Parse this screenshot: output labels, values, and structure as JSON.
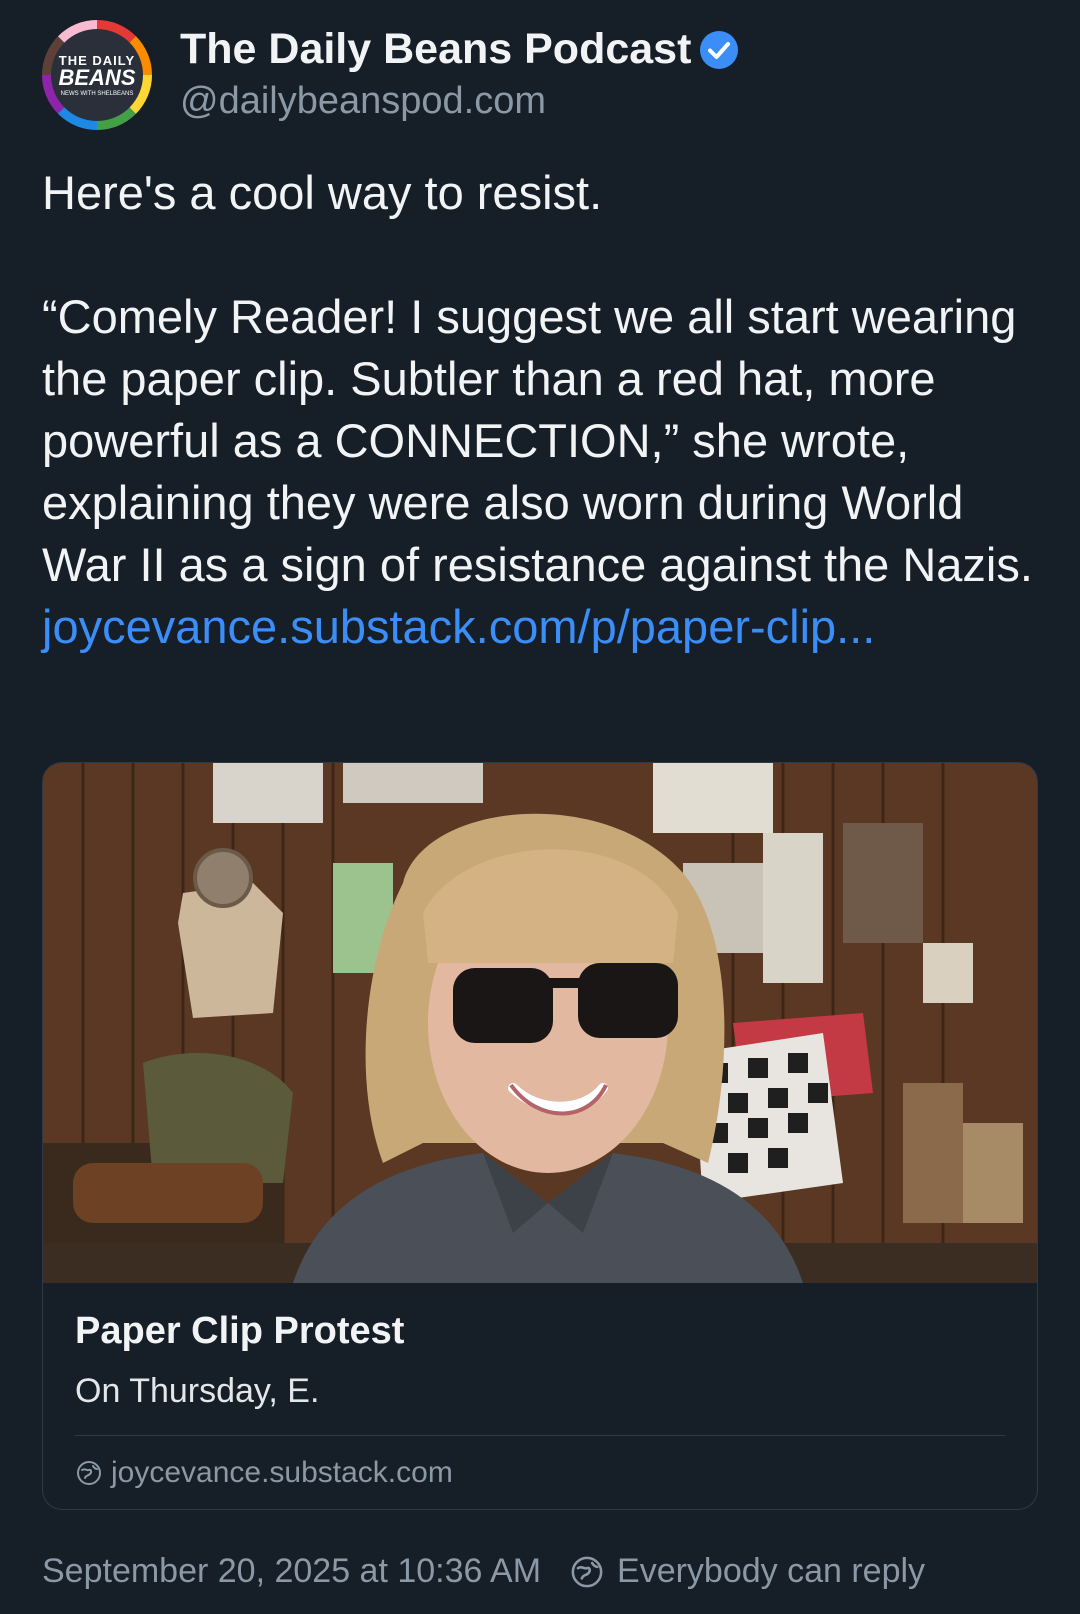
{
  "author": {
    "display_name": "The Daily Beans Podcast",
    "handle": "@dailybeanspod.com",
    "avatar_text": {
      "line1": "THE DAILY",
      "line2": "BEANS",
      "line3": "NEWS WITH SHELBEANS"
    },
    "verified_icon": "verified-check-icon"
  },
  "post": {
    "line1": "Here's a cool way to resist.",
    "quote": "“Comely Reader! I suggest we all start wearing the paper clip. Subtler than a red hat, more powerful as a CONNECTION,” she wrote, explaining they were also worn during World War II as a sign of resistance against the Nazis.",
    "link_text": "joycevance.substack.com/p/paper-clip..."
  },
  "card": {
    "title": "Paper Clip Protest",
    "description": "On Thursday, E.",
    "domain": "joycevance.substack.com",
    "domain_icon": "globe-icon"
  },
  "footer": {
    "timestamp": "September 20, 2025 at 10:36 AM",
    "reply_setting": "Everybody can reply",
    "reply_icon": "globe-icon"
  },
  "colors": {
    "background": "#161e27",
    "link": "#3b8ef7",
    "muted": "#8b98a5",
    "verified": "#3b8ef7"
  }
}
